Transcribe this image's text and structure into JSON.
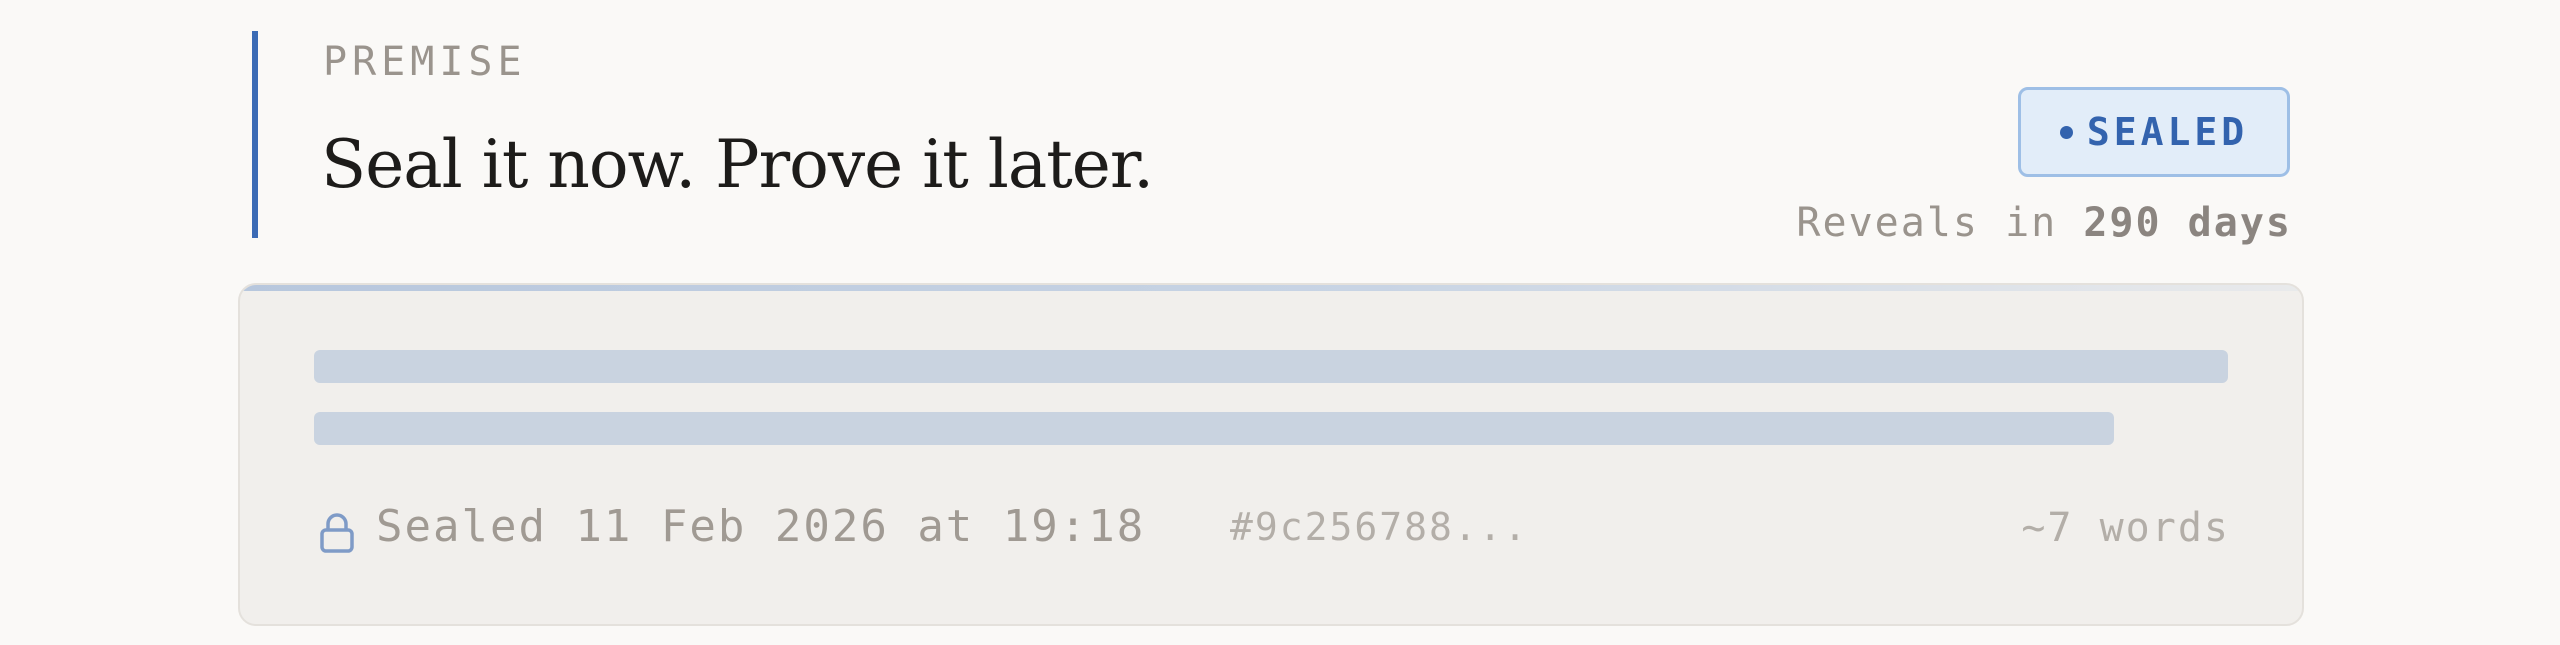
{
  "premise": {
    "kicker": "PREMISE",
    "headline": "Seal it now. Prove it later."
  },
  "status": {
    "badge_label": "SEALED",
    "reveal_prefix": "Reveals in",
    "reveal_value": "290 days"
  },
  "card": {
    "sealed_label": "Sealed 11 Feb 2026 at 19:18",
    "hash": "#9c256788...",
    "word_count": "~7 words",
    "icon": "lock-icon"
  },
  "colors": {
    "accent": "#3b6bb5",
    "badge_bg": "#e2edf9",
    "redacted_line": "#c9d3e0"
  }
}
